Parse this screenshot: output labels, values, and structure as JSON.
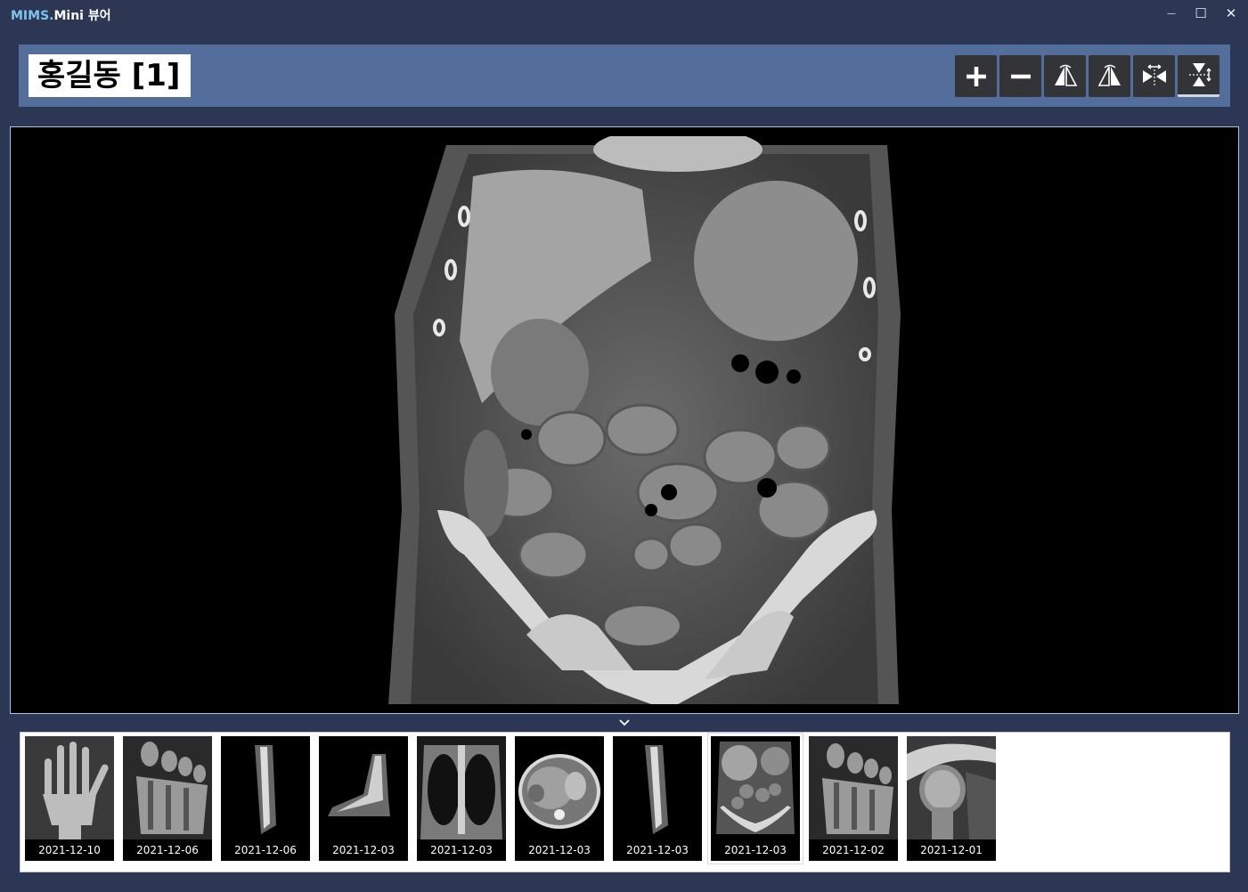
{
  "window": {
    "brand": "MIMS.",
    "title_rest": "Mini 뷰어",
    "controls": {
      "minimize": "—",
      "maximize": "☐",
      "close": "✕"
    }
  },
  "patient": {
    "name": "홍길동 [1]"
  },
  "toolbar": {
    "buttons": [
      {
        "icon": "zoom-in-icon"
      },
      {
        "icon": "zoom-out-icon"
      },
      {
        "icon": "flip-horizontal-icon"
      },
      {
        "icon": "rotate-flip-icon"
      },
      {
        "icon": "fit-horizontal-icon"
      },
      {
        "icon": "fit-vertical-icon",
        "active": true
      }
    ]
  },
  "viewer": {
    "image": "coronal-abdomen-ct"
  },
  "thumbnails": [
    {
      "date": "2021-12-10",
      "kind": "hand-xray"
    },
    {
      "date": "2021-12-06",
      "kind": "foot-mri"
    },
    {
      "date": "2021-12-06",
      "kind": "lower-leg-ct"
    },
    {
      "date": "2021-12-03",
      "kind": "foot-ct"
    },
    {
      "date": "2021-12-03",
      "kind": "chest-ct"
    },
    {
      "date": "2021-12-03",
      "kind": "abdomen-axial-ct"
    },
    {
      "date": "2021-12-03",
      "kind": "lower-leg-ct"
    },
    {
      "date": "2021-12-03",
      "kind": "abdomen-coronal-ct",
      "selected": true
    },
    {
      "date": "2021-12-02",
      "kind": "foot-mri"
    },
    {
      "date": "2021-12-01",
      "kind": "shoulder-mri"
    }
  ],
  "colors": {
    "background": "#2c3655",
    "header": "#536e9b",
    "brand": "#7cc4ee",
    "viewer_border": "#9fc7e2"
  }
}
